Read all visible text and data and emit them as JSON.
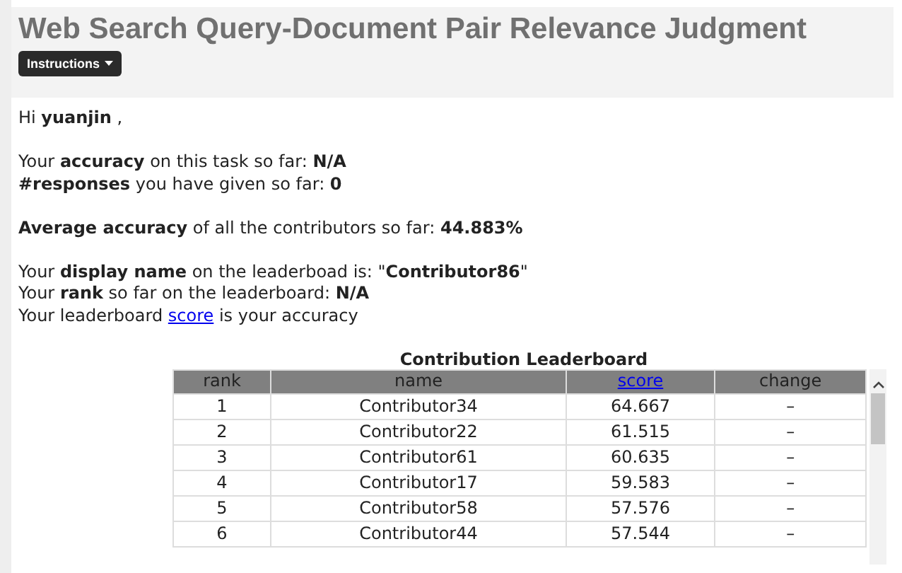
{
  "header": {
    "title": "Web Search Query-Document Pair Relevance Judgment",
    "button": "Instructions"
  },
  "paragraphs": [
    [
      {
        "text": "Hi **yuanjin** ,"
      }
    ],
    [
      {
        "text": "Your **accuracy** on this task so far: **N/A**"
      },
      {
        "text": "**#responses** you have given so far: **0**"
      }
    ],
    [
      {
        "text": "**Average accuracy** of all the contributors so far: **44.883%**"
      }
    ],
    [
      {
        "text": "Your **display name** on the leaderboad is: \"**Contributor86**\""
      },
      {
        "text": "Your **rank** so far on the leaderboard: **N/A**"
      },
      {
        "text": "Your leaderboard ",
        "link": "score",
        "after": " is your accuracy"
      }
    ]
  ],
  "leaderboard": {
    "caption": "Contribution Leaderboard",
    "columns": [
      {
        "label": "rank",
        "kind": "text"
      },
      {
        "label": "name",
        "kind": "text"
      },
      {
        "label": "score",
        "kind": "link"
      },
      {
        "label": "change",
        "kind": "text"
      }
    ],
    "rows": [
      [
        "1",
        "Contributor34",
        "64.667",
        "–"
      ],
      [
        "2",
        "Contributor22",
        "61.515",
        "–"
      ],
      [
        "3",
        "Contributor61",
        "60.635",
        "–"
      ],
      [
        "4",
        "Contributor17",
        "59.583",
        "–"
      ],
      [
        "5",
        "Contributor58",
        "57.576",
        "–"
      ],
      [
        "6",
        "Contributor44",
        "57.544",
        "–"
      ]
    ]
  }
}
